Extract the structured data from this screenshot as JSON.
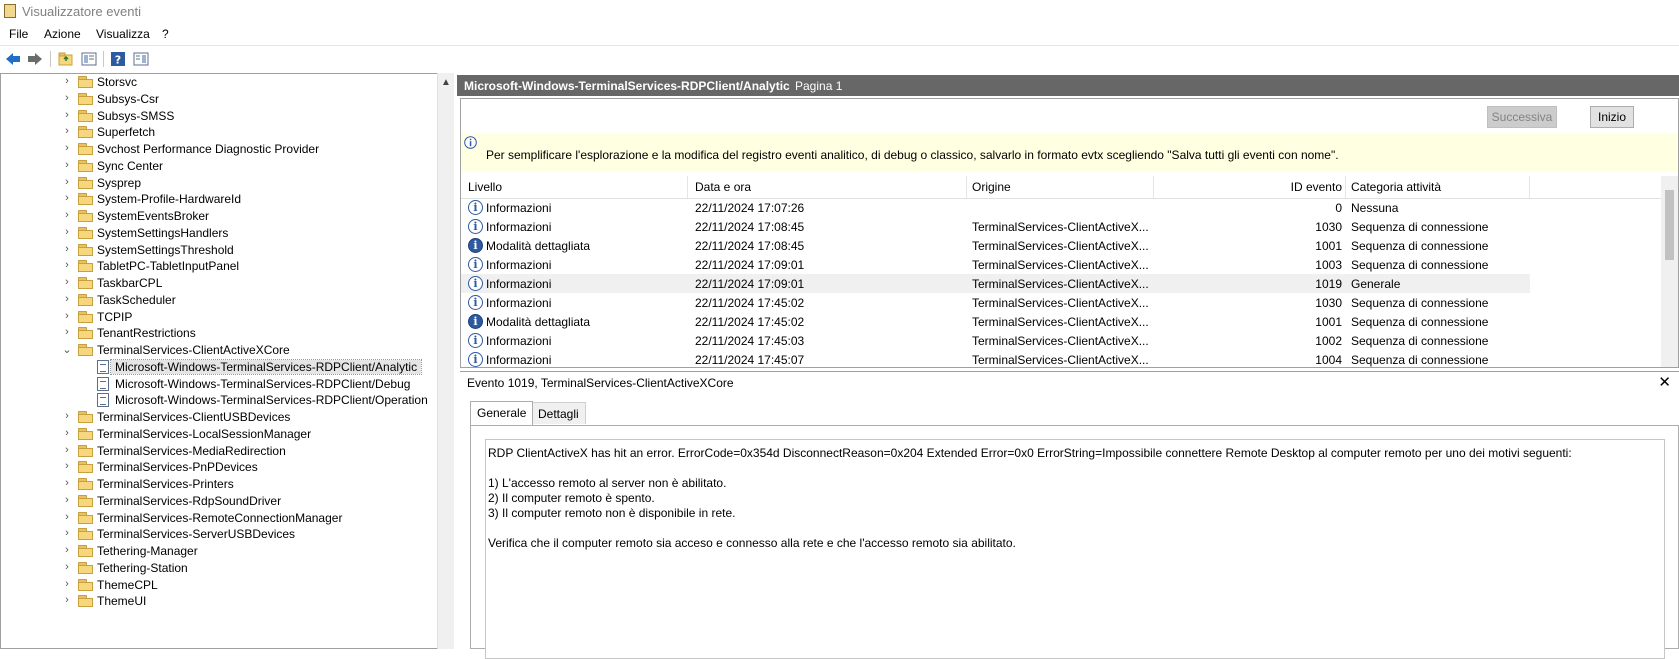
{
  "window": {
    "title": "Visualizzatore eventi"
  },
  "menu": [
    "File",
    "Azione",
    "Visualizza",
    "?"
  ],
  "toolbar_icons": [
    "back-arrow-icon",
    "forward-arrow-icon",
    "open-folder-icon",
    "properties-icon",
    "help-icon",
    "show-pane-icon"
  ],
  "tree": {
    "items": [
      {
        "label": "Storsvc",
        "type": "folder",
        "expanded": false
      },
      {
        "label": "Subsys-Csr",
        "type": "folder",
        "expanded": false
      },
      {
        "label": "Subsys-SMSS",
        "type": "folder",
        "expanded": false
      },
      {
        "label": "Superfetch",
        "type": "folder",
        "expanded": false
      },
      {
        "label": "Svchost Performance Diagnostic Provider",
        "type": "folder",
        "expanded": false
      },
      {
        "label": "Sync Center",
        "type": "folder",
        "expanded": false
      },
      {
        "label": "Sysprep",
        "type": "folder",
        "expanded": false
      },
      {
        "label": "System-Profile-HardwareId",
        "type": "folder",
        "expanded": false
      },
      {
        "label": "SystemEventsBroker",
        "type": "folder",
        "expanded": false
      },
      {
        "label": "SystemSettingsHandlers",
        "type": "folder",
        "expanded": false
      },
      {
        "label": "SystemSettingsThreshold",
        "type": "folder",
        "expanded": false
      },
      {
        "label": "TabletPC-TabletInputPanel",
        "type": "folder",
        "expanded": false
      },
      {
        "label": "TaskbarCPL",
        "type": "folder",
        "expanded": false
      },
      {
        "label": "TaskScheduler",
        "type": "folder",
        "expanded": false
      },
      {
        "label": "TCPIP",
        "type": "folder",
        "expanded": false
      },
      {
        "label": "TenantRestrictions",
        "type": "folder",
        "expanded": false
      },
      {
        "label": "TerminalServices-ClientActiveXCore",
        "type": "folder",
        "expanded": true
      },
      {
        "label": "Microsoft-Windows-TerminalServices-RDPClient/Analytic",
        "type": "log",
        "selected": true
      },
      {
        "label": "Microsoft-Windows-TerminalServices-RDPClient/Debug",
        "type": "log"
      },
      {
        "label": "Microsoft-Windows-TerminalServices-RDPClient/Operation",
        "type": "log"
      },
      {
        "label": "TerminalServices-ClientUSBDevices",
        "type": "folder",
        "expanded": false
      },
      {
        "label": "TerminalServices-LocalSessionManager",
        "type": "folder",
        "expanded": false
      },
      {
        "label": "TerminalServices-MediaRedirection",
        "type": "folder",
        "expanded": false
      },
      {
        "label": "TerminalServices-PnPDevices",
        "type": "folder",
        "expanded": false
      },
      {
        "label": "TerminalServices-Printers",
        "type": "folder",
        "expanded": false
      },
      {
        "label": "TerminalServices-RdpSoundDriver",
        "type": "folder",
        "expanded": false
      },
      {
        "label": "TerminalServices-RemoteConnectionManager",
        "type": "folder",
        "expanded": false
      },
      {
        "label": "TerminalServices-ServerUSBDevices",
        "type": "folder",
        "expanded": false
      },
      {
        "label": "Tethering-Manager",
        "type": "folder",
        "expanded": false
      },
      {
        "label": "Tethering-Station",
        "type": "folder",
        "expanded": false
      },
      {
        "label": "ThemeCPL",
        "type": "folder",
        "expanded": false
      },
      {
        "label": "ThemeUI",
        "type": "folder",
        "expanded": false
      }
    ]
  },
  "log_header": {
    "title": "Microsoft-Windows-TerminalServices-RDPClient/Analytic",
    "page": "Pagina 1"
  },
  "buttons": {
    "next": "Successiva",
    "start": "Inizio"
  },
  "info_banner": "Per semplificare l'esplorazione e la modifica del registro eventi analitico, di debug o classico, salvarlo in formato evtx scegliendo \"Salva tutti gli eventi con nome\".",
  "columns": {
    "level": "Livello",
    "date": "Data e ora",
    "source": "Origine",
    "id": "ID evento",
    "category": "Categoria attività"
  },
  "events": [
    {
      "level": "Informazioni",
      "kind": "info",
      "date": "22/11/2024 17:07:26",
      "source": "",
      "id": "0",
      "category": "Nessuna"
    },
    {
      "level": "Informazioni",
      "kind": "info",
      "date": "22/11/2024 17:08:45",
      "source": "TerminalServices-ClientActiveX...",
      "id": "1030",
      "category": "Sequenza di connessione"
    },
    {
      "level": "Modalità dettagliata",
      "kind": "verbose",
      "date": "22/11/2024 17:08:45",
      "source": "TerminalServices-ClientActiveX...",
      "id": "1001",
      "category": "Sequenza di connessione"
    },
    {
      "level": "Informazioni",
      "kind": "info",
      "date": "22/11/2024 17:09:01",
      "source": "TerminalServices-ClientActiveX...",
      "id": "1003",
      "category": "Sequenza di connessione"
    },
    {
      "level": "Informazioni",
      "kind": "info",
      "date": "22/11/2024 17:09:01",
      "source": "TerminalServices-ClientActiveX...",
      "id": "1019",
      "category": "Generale",
      "selected": true
    },
    {
      "level": "Informazioni",
      "kind": "info",
      "date": "22/11/2024 17:45:02",
      "source": "TerminalServices-ClientActiveX...",
      "id": "1030",
      "category": "Sequenza di connessione"
    },
    {
      "level": "Modalità dettagliata",
      "kind": "verbose",
      "date": "22/11/2024 17:45:02",
      "source": "TerminalServices-ClientActiveX...",
      "id": "1001",
      "category": "Sequenza di connessione"
    },
    {
      "level": "Informazioni",
      "kind": "info",
      "date": "22/11/2024 17:45:03",
      "source": "TerminalServices-ClientActiveX...",
      "id": "1002",
      "category": "Sequenza di connessione"
    },
    {
      "level": "Informazioni",
      "kind": "info",
      "date": "22/11/2024 17:45:07",
      "source": "TerminalServices-ClientActiveX...",
      "id": "1004",
      "category": "Sequenza di connessione"
    }
  ],
  "detail": {
    "title": "Evento 1019, TerminalServices-ClientActiveXCore",
    "tabs": [
      "Generale",
      "Dettagli"
    ],
    "message": "RDP ClientActiveX has hit an error. ErrorCode=0x354d DisconnectReason=0x204 Extended Error=0x0 ErrorString=Impossibile connettere Remote Desktop al computer remoto per uno dei motivi seguenti:\n\n1) L'accesso remoto al server non è abilitato.\n2) Il computer remoto è spento.\n3) Il computer remoto non è disponibile in rete.\n\nVerifica che il computer remoto sia acceso e connesso alla rete e che l'accesso remoto sia abilitato."
  }
}
